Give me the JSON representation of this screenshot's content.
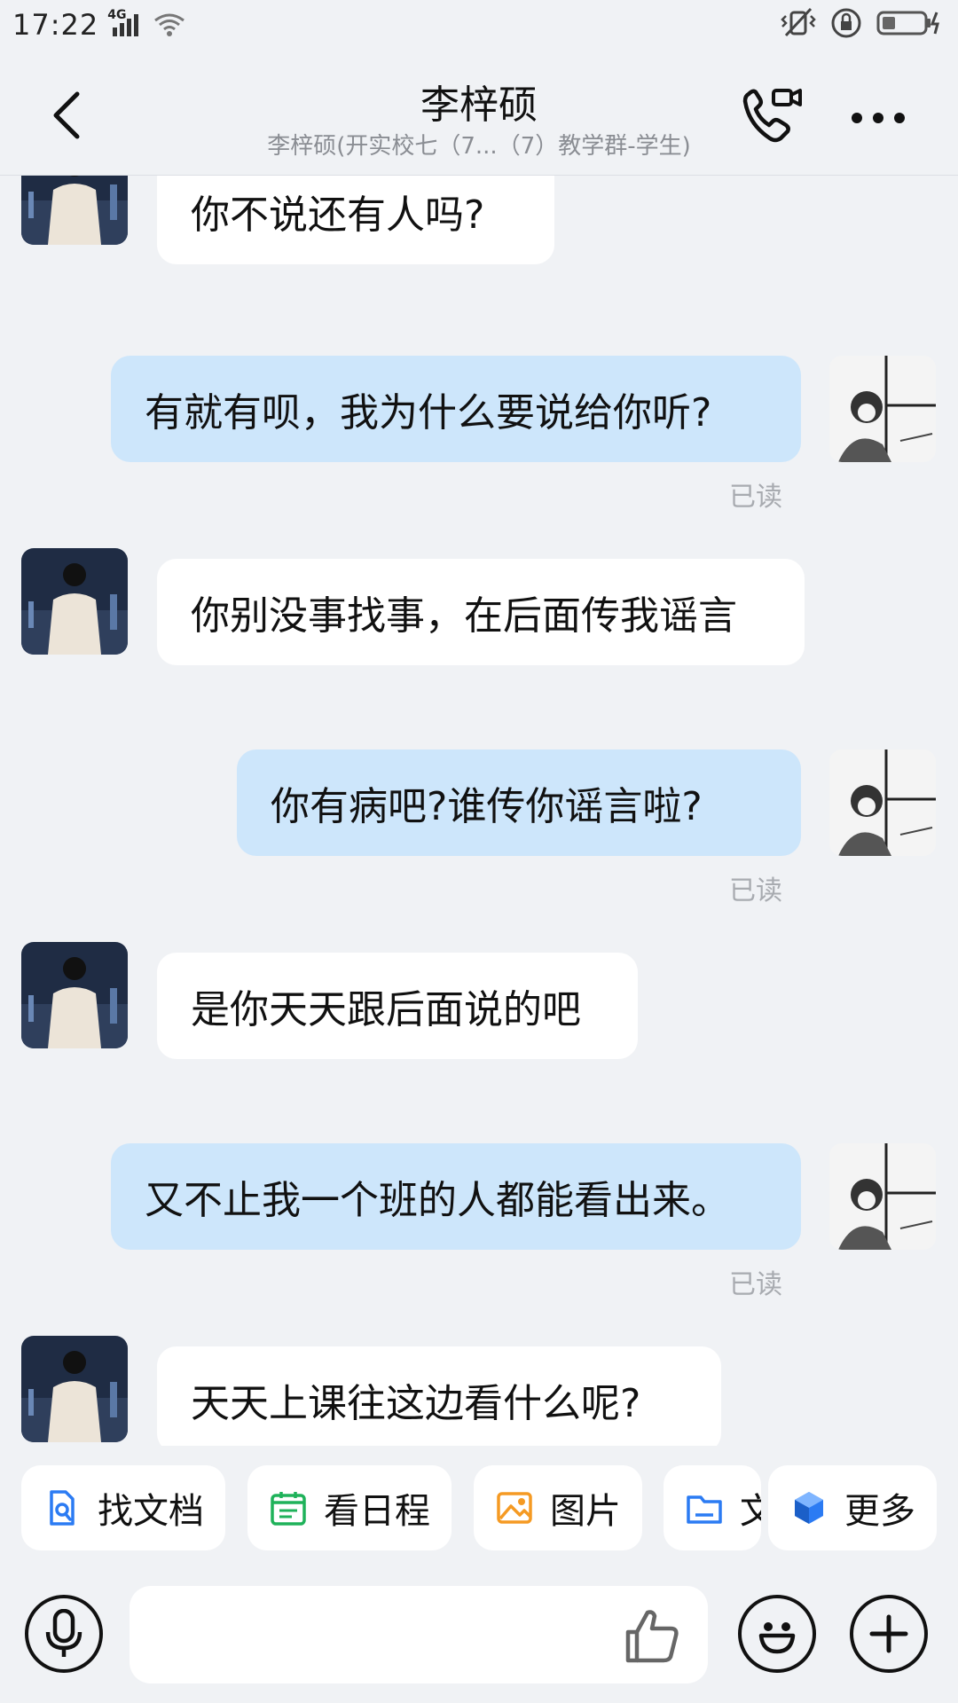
{
  "status_bar": {
    "time": "17:22",
    "network": "4G",
    "icons": [
      "signal-icon",
      "wifi-icon",
      "vibrate-icon",
      "rotation-lock-icon",
      "battery-charging-icon"
    ]
  },
  "header": {
    "title": "李梓硕",
    "subtitle": "李梓硕(开实校七（7...（7）教学群-学生)",
    "back_icon": "back-arrow-icon",
    "call_icon": "video-call-icon",
    "more_icon": "more-dots-icon"
  },
  "messages": [
    {
      "side": "left",
      "text": "你不说还有人吗?"
    },
    {
      "side": "right",
      "text": "有就有呗，我为什么要说给你听?",
      "status": "已读"
    },
    {
      "side": "left",
      "text": "你别没事找事，在后面传我谣言"
    },
    {
      "side": "right",
      "text": "你有病吧?谁传你谣言啦?",
      "status": "已读"
    },
    {
      "side": "left",
      "text": "是你天天跟后面说的吧"
    },
    {
      "side": "right",
      "text": "又不止我一个班的人都能看出来。",
      "status": "已读"
    },
    {
      "side": "left",
      "text": "天天上课往这边看什么呢?"
    }
  ],
  "quick_actions": [
    {
      "label": "找文档",
      "icon": "search-document-icon",
      "color": "#2b7bf3"
    },
    {
      "label": "看日程",
      "icon": "calendar-icon",
      "color": "#1fb25a"
    },
    {
      "label": "图片",
      "icon": "image-icon",
      "color": "#f59a23"
    },
    {
      "label": "文",
      "icon": "folder-icon",
      "color": "#2b7bf3"
    },
    {
      "label": "更多",
      "icon": "more-apps-icon",
      "color": "#2b7bf3"
    }
  ],
  "input": {
    "placeholder": "",
    "voice_icon": "microphone-icon",
    "like_icon": "thumbs-up-icon",
    "emoji_icon": "emoji-icon",
    "plus_icon": "plus-icon"
  }
}
